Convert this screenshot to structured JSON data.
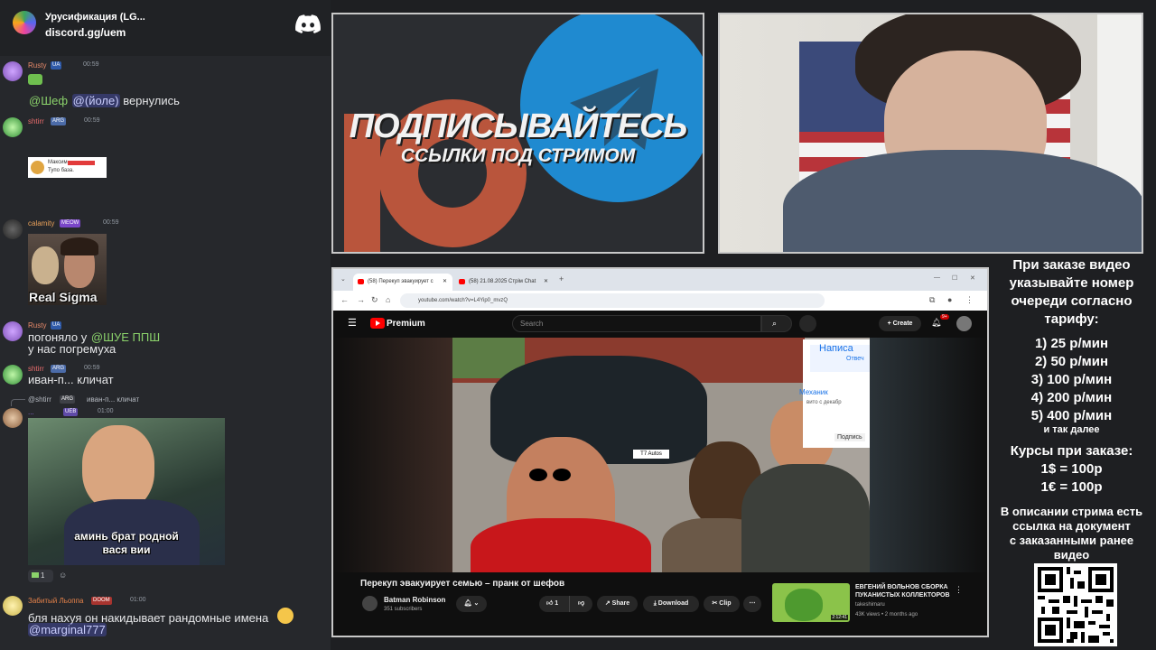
{
  "discord": {
    "server_name": "Урусификация (LG...",
    "invite": "discord.gg/uem",
    "messages": [
      {
        "user": "Rusty",
        "badge1": "UA",
        "time": "00:59",
        "text": "",
        "mentions": [
          "@Шеф",
          "@(йоле)"
        ],
        "after": "вернулись"
      },
      {
        "user": "shtirr",
        "badge1": "ARG",
        "time": "00:59",
        "embed_name": "Максим",
        "embed_text": "Тупо база."
      },
      {
        "user": "calamity",
        "badge1": "MEOW",
        "time": "00:59",
        "image_caption": "Real Sigma"
      },
      {
        "user": "Rusty",
        "badge1": "UA",
        "time": "",
        "text": "погоняло у",
        "mention": "@ШУЕ ППШ",
        "text2": "у нас погремуха"
      },
      {
        "user": "shtirr",
        "badge1": "ARG",
        "time": "00:59",
        "text": "иван-п... кличат"
      },
      {
        "reply_user": "@shtirr",
        "reply_badge": "ARG",
        "reply_text": "иван-п... кличат",
        "user": "...",
        "badge1": "UEB",
        "time": "01:00",
        "video_caption_1": "аминь брат родной",
        "video_caption_2": "вася вии",
        "reaction_count": "1"
      },
      {
        "user": "Забитый Льоппа",
        "badge1": "DOOM",
        "time": "01:00",
        "text": "бля нахуя он накидывает рандомные имена",
        "mention": "@marginal777"
      }
    ]
  },
  "banner": {
    "title": "ПОДПИСЫВАЙТЕСЬ",
    "subtitle": "ССЫЛКИ ПОД СТРИМОМ"
  },
  "browser": {
    "tab1": "(58) Перекуп эвакуирует с",
    "tab2": "(58) 21.08.2025 Стрім Chat",
    "url": "youtube.com/watch?v=L4Yip0_mvzQ",
    "yt_brand": "Premium",
    "search_placeholder": "Search",
    "create_label": "Create",
    "notif_count": "9+",
    "video_title": "Перекуп эвакуирует семью – пранк от шефов",
    "channel_name": "Batman Robinson",
    "subscribers": "351 subscribers",
    "like_count": "1",
    "share_label": "Share",
    "download_label": "Download",
    "clip_label": "Clip",
    "plate_text": "T7 Autos",
    "bubble_title": "Написа",
    "bubble_sub": "Отвеч",
    "bubble_mech": "Механик",
    "bubble_avito": "вито с декабр",
    "bubble_btn": "Подпись",
    "rec_title": "ЕВГЕНИЙ ВОЛЬНОВ СБОРКА ПУКАНИСТЫХ КОЛЛЕКТОРОВ",
    "rec_channel": "takeshimaru",
    "rec_meta": "43K views • 2 months ago",
    "rec_duration": "2:12:41"
  },
  "pricing": {
    "intro": [
      "При заказе видео",
      "указывайте номер",
      "очереди согласно",
      "тарифу:"
    ],
    "tiers": [
      "1) 25 р/мин",
      "2) 50 р/мин",
      "3) 100 р/мин",
      "4) 200 р/мин",
      "5) 400 р/мин"
    ],
    "etc": "и так далее",
    "courses_title": "Курсы при заказе:",
    "rates": [
      "1$ = 100р",
      "1€ = 100р"
    ],
    "desc": [
      "В описании стрима есть",
      "ссылка на документ",
      "с заказанными ранее",
      "видео"
    ]
  },
  "colors": {
    "accent_green": "#8bd26b",
    "mention_bg": "#5865f2",
    "yt_red": "#ff0000"
  }
}
